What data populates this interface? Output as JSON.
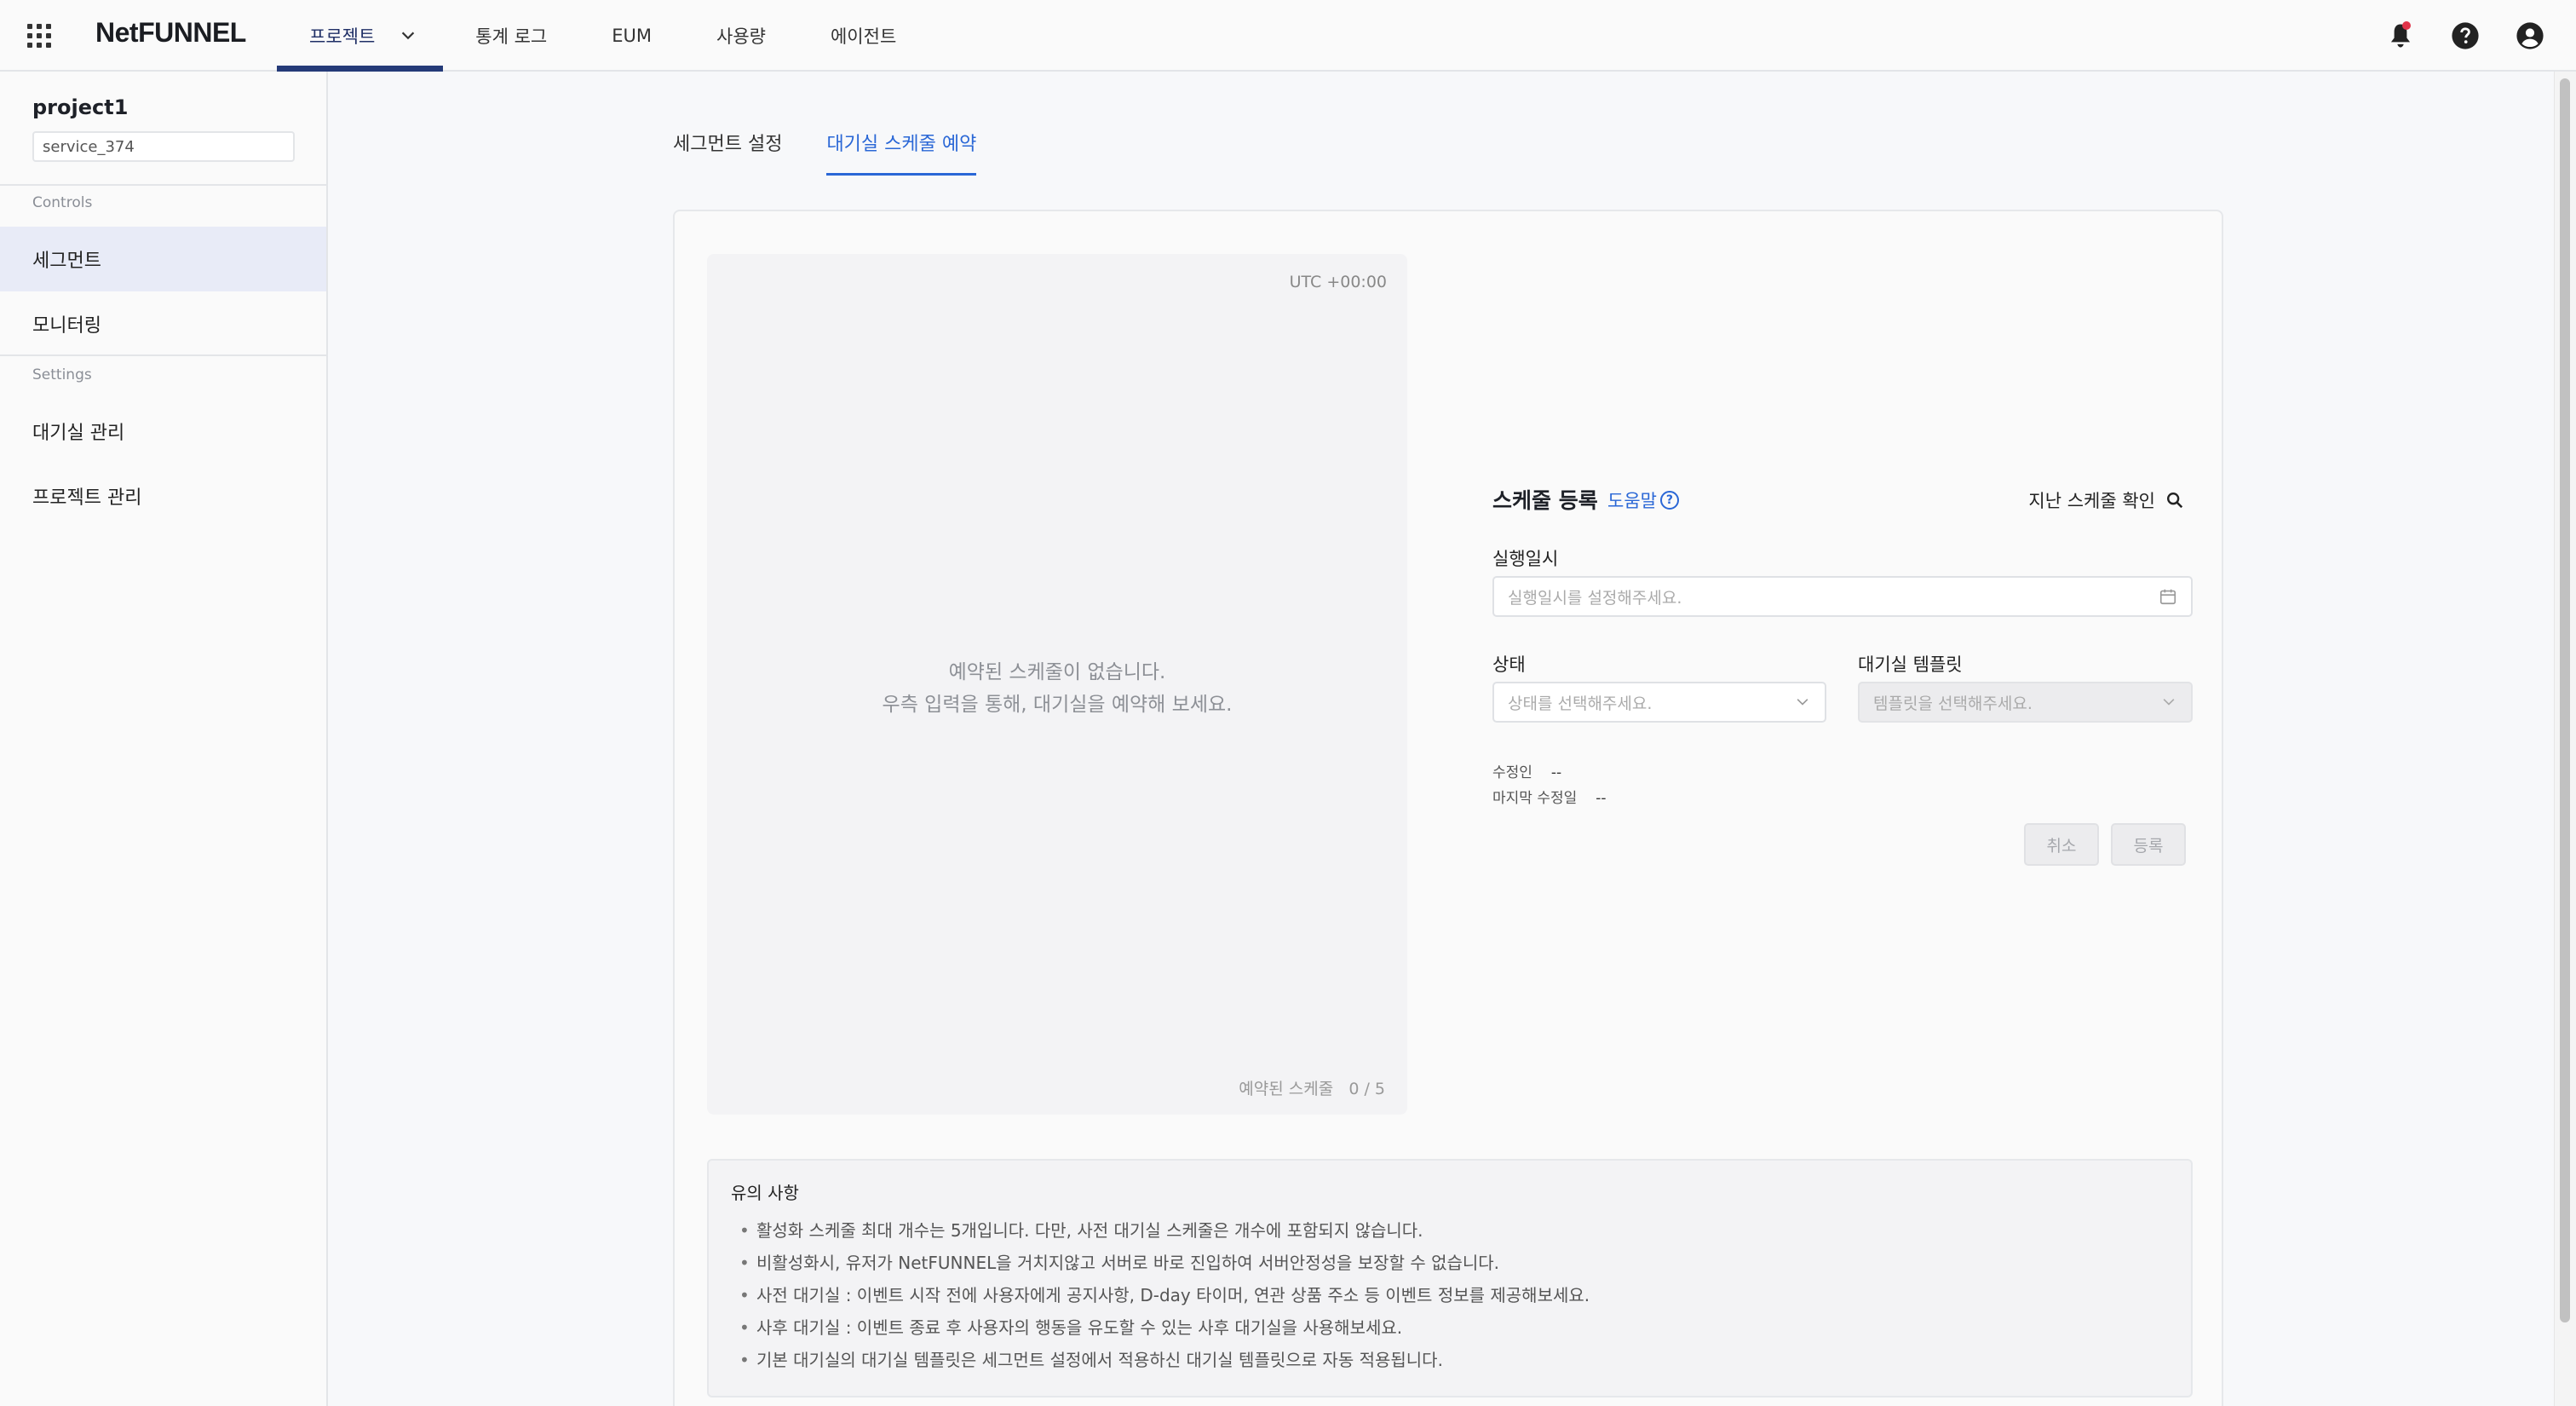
{
  "app": {
    "logo": "NetFUNNEL"
  },
  "nav": {
    "items": [
      {
        "label": "프로젝트",
        "active": true
      },
      {
        "label": "통계 로그",
        "active": false
      },
      {
        "label": "EUM",
        "active": false
      },
      {
        "label": "사용량",
        "active": false
      },
      {
        "label": "에이전트",
        "active": false
      }
    ]
  },
  "top_icons": [
    "apps-grid-icon",
    "bell-icon",
    "help-icon",
    "account-icon"
  ],
  "sidebar": {
    "project_name": "project1",
    "service_name": "service_374",
    "sections": [
      {
        "title": "Controls",
        "items": [
          "세그먼트",
          "모니터링"
        ]
      },
      {
        "title": "Settings",
        "items": [
          "대기실 관리",
          "프로젝트 관리"
        ]
      }
    ],
    "active_item": "세그먼트"
  },
  "tabs": [
    {
      "label": "세그먼트 설정",
      "active": false
    },
    {
      "label": "대기실 스케줄 예약",
      "active": true
    }
  ],
  "schedule_list": {
    "timezone": "UTC +00:00",
    "empty_line1": "예약된 스케줄이 없습니다.",
    "empty_line2": "우측 입력을 통해, 대기실을 예약해 보세요.",
    "count_label": "예약된 스케줄",
    "count_value": "0 / 5"
  },
  "form": {
    "title": "스케줄 등록",
    "help_label": "도움말",
    "past_label": "지난 스케줄 확인",
    "datetime_label": "실행일시",
    "datetime_placeholder": "실행일시를 설정해주세요.",
    "status_label": "상태",
    "status_placeholder": "상태를 선택해주세요.",
    "template_label": "대기실 템플릿",
    "template_placeholder": "템플릿을 선택해주세요.",
    "modifier_label": "수정인",
    "modifier_value": "--",
    "modified_label": "마지막 수정일",
    "modified_value": "--",
    "cancel_label": "취소",
    "submit_label": "등록"
  },
  "notes": {
    "title": "유의 사항",
    "items": [
      "활성화 스케줄 최대 개수는 5개입니다. 다만, 사전 대기실 스케줄은 개수에 포함되지 않습니다.",
      "비활성화시, 유저가 NetFUNNEL을 거치지않고 서버로 바로 진입하여 서버안정성을 보장할 수 없습니다.",
      "사전 대기실 : 이벤트 시작 전에 사용자에게 공지사항, D-day 타이머, 연관 상품 주소 등 이벤트 정보를 제공해보세요.",
      "사후 대기실 : 이벤트 종료 후 사용자의 행동을 유도할 수 있는 사후 대기실을 사용해보세요.",
      "기본 대기실의 대기실 템플릿은 세그먼트 설정에서 적용하신 대기실 템플릿으로 자동 적용됩니다."
    ]
  },
  "colors": {
    "brand_nav": "#243a78",
    "accent": "#2a67d6",
    "notification": "#e0344a",
    "sidebar_active": "#e8ebf7"
  }
}
